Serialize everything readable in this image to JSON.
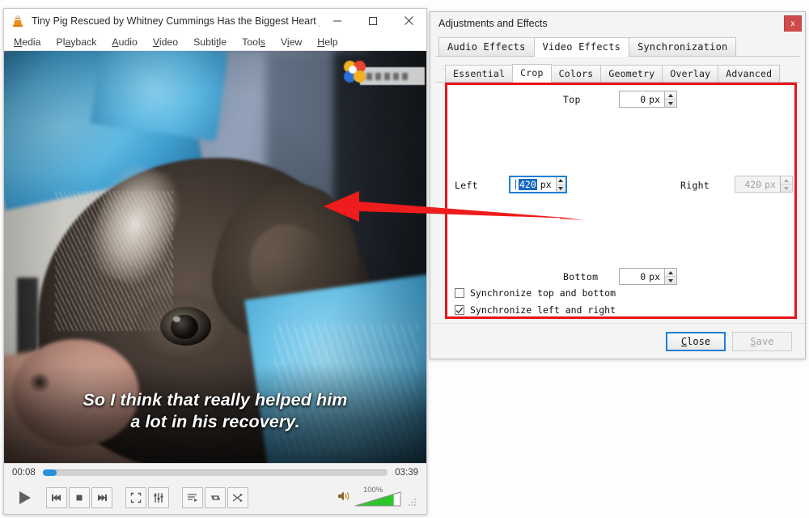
{
  "player": {
    "title": "Tiny Pig Rescued by Whitney Cummings Has the Biggest Heart _ Th...",
    "app_icon": "vlc-cone-icon",
    "window_buttons": {
      "minimize": "minimize-icon",
      "maximize": "maximize-icon",
      "close": "close-icon"
    },
    "menu": [
      {
        "label": "Media",
        "accel": "M"
      },
      {
        "label": "Playback",
        "accel": "a"
      },
      {
        "label": "Audio",
        "accel": "A"
      },
      {
        "label": "Video",
        "accel": "V"
      },
      {
        "label": "Subtitle",
        "accel": "t"
      },
      {
        "label": "Tools",
        "accel": "s"
      },
      {
        "label": "View",
        "accel": "i"
      },
      {
        "label": "Help",
        "accel": "H"
      }
    ],
    "subtitle_line1": "So I think that really helped him",
    "subtitle_line2": "a lot in his recovery.",
    "elapsed": "00:08",
    "total": "03:39",
    "progress_percent": 4,
    "volume_label": "100%",
    "volume_percent": 85,
    "controls": [
      "play-button",
      "previous-button",
      "stop-button",
      "next-button",
      "fullscreen-button",
      "extended-settings-button",
      "playlist-button",
      "loop-button",
      "shuffle-button"
    ]
  },
  "dialog": {
    "title": "Adjustments and Effects",
    "close_label": "x",
    "main_tabs": [
      {
        "label": "Audio Effects",
        "active": false
      },
      {
        "label": "Video Effects",
        "active": true
      },
      {
        "label": "Synchronization",
        "active": false
      }
    ],
    "sub_tabs": [
      {
        "label": "Essential",
        "active": false
      },
      {
        "label": "Crop",
        "active": true
      },
      {
        "label": "Colors",
        "active": false
      },
      {
        "label": "Geometry",
        "active": false
      },
      {
        "label": "Overlay",
        "active": false
      },
      {
        "label": "Advanced",
        "active": false
      }
    ],
    "crop": {
      "top_label": "Top",
      "top_value": "0",
      "left_label": "Left",
      "left_value": "420",
      "right_label": "Right",
      "right_value": "420",
      "bottom_label": "Bottom",
      "bottom_value": "0",
      "unit": "px",
      "sync_top_bottom_label": "Synchronize top and bottom",
      "sync_top_bottom_checked": false,
      "sync_left_right_label": "Synchronize left and right",
      "sync_left_right_checked": true,
      "highlight_color": "#e8131a"
    },
    "footer": {
      "close_label": "Close",
      "close_accel": "C",
      "save_label": "Save",
      "save_accel": "S",
      "save_enabled": false
    }
  },
  "annotation": {
    "arrow_color": "#e8131a",
    "arrow_name": "red-pointer-arrow"
  }
}
